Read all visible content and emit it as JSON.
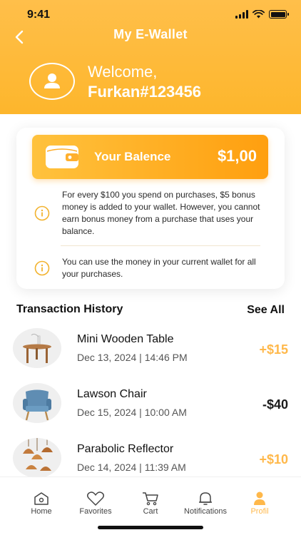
{
  "status_bar": {
    "time": "9:41"
  },
  "header": {
    "title": "My E-Wallet",
    "welcome": "Welcome,",
    "username": "Furkan#123456"
  },
  "balance": {
    "label": "Your Balence",
    "amount": "$1,00"
  },
  "info": [
    {
      "text": "For every $100 you spend on purchases, $5 bonus money is added to your wallet. However, you cannot earn bonus money from a purchase that uses your balance."
    },
    {
      "text": "You can use the money in your current wallet for all your purchases."
    }
  ],
  "transactions": {
    "title": "Transaction History",
    "see_all": "See All",
    "items": [
      {
        "name": "Mini Wooden Table",
        "date": "Dec 13, 2024 | 14:46 PM",
        "amount": "+$15",
        "thumb_icon": "table-icon"
      },
      {
        "name": "Lawson Chair",
        "date": "Dec 15, 2024 | 10:00 AM",
        "amount": "-$40",
        "thumb_icon": "chair-icon"
      },
      {
        "name": "Parabolic Reflector",
        "date": "Dec 14, 2024 | 11:39 AM",
        "amount": "+$10",
        "thumb_icon": "lamp-icon"
      }
    ]
  },
  "tabs": [
    {
      "label": "Home",
      "icon": "home-icon"
    },
    {
      "label": "Favorites",
      "icon": "heart-icon"
    },
    {
      "label": "Cart",
      "icon": "cart-icon"
    },
    {
      "label": "Notifications",
      "icon": "bell-icon"
    },
    {
      "label": "Profil",
      "icon": "user-icon",
      "active": true
    }
  ],
  "colors": {
    "accent": "#FDB62C",
    "accent_dark": "#FF9F0F",
    "positive": "#FFB84A"
  }
}
